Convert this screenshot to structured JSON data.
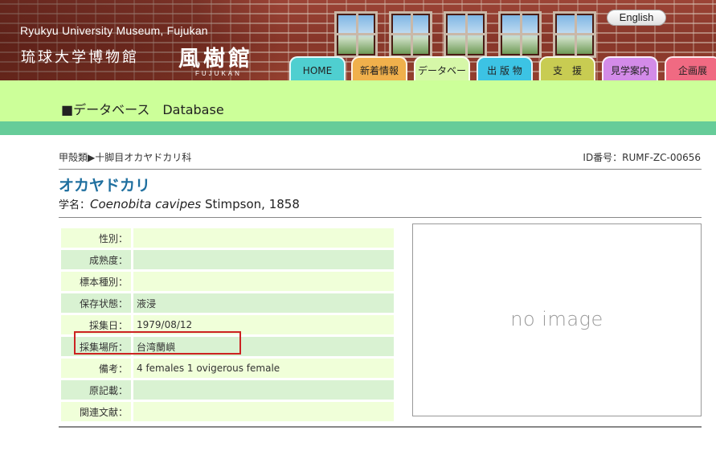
{
  "header": {
    "logo_en": "Ryukyu University Museum, Fujukan",
    "logo_jp": "琉球大学博物館",
    "logo_big": "風樹館",
    "logo_sub": "FUJUKAN",
    "lang_button": "English",
    "nav": [
      {
        "label": "HOME",
        "color": "#4fcfd0"
      },
      {
        "label": "新着情報",
        "color": "#f0b04c"
      },
      {
        "label": "データベース",
        "color": "#d6f7a8"
      },
      {
        "label": "出 版 物",
        "color": "#3cc3e4"
      },
      {
        "label": "支　援",
        "color": "#c8cc52"
      },
      {
        "label": "見学案内",
        "color": "#d38be8"
      },
      {
        "label": "企画展",
        "color": "#f06a82"
      }
    ]
  },
  "page_title": "■データベース　Database",
  "breadcrumb": "甲殻類▶十脚目オカヤドカリ科",
  "id_label": "ID番号：RUMF-ZC-00656",
  "species": {
    "name_jp": "オカヤドカリ",
    "sci_label": "学名：",
    "sci_name": "Coenobita cavipes",
    "sci_author": "Stimpson, 1858"
  },
  "attributes": [
    {
      "key": "性別：",
      "value": ""
    },
    {
      "key": "成熟度：",
      "value": ""
    },
    {
      "key": "標本種別：",
      "value": ""
    },
    {
      "key": "保存状態：",
      "value": "液浸"
    },
    {
      "key": "採集日：",
      "value": "1979/08/12"
    },
    {
      "key": "採集場所：",
      "value": "台湾蘭嶼"
    },
    {
      "key": "備考：",
      "value": "4 females 1 ovigerous female"
    },
    {
      "key": "原記載：",
      "value": ""
    },
    {
      "key": "関連文献：",
      "value": ""
    }
  ],
  "image_placeholder": "no image"
}
